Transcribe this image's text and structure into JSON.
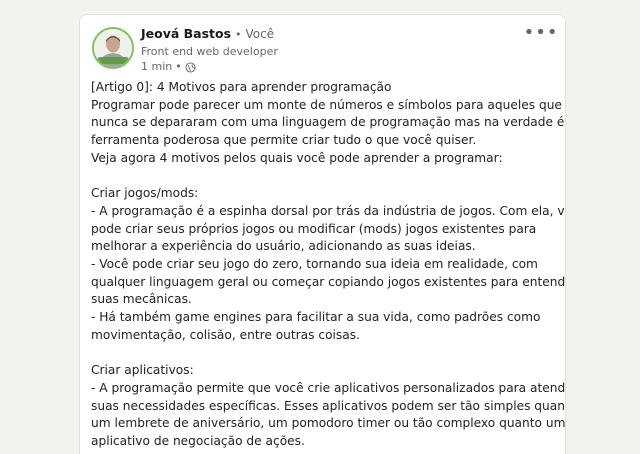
{
  "post": {
    "author": "Jeová Bastos",
    "separator": "•",
    "relation": "Você",
    "headline": "Front end web developer",
    "time": "1 min",
    "visibility_icon": "globe-icon",
    "more_icon": "more-options-icon",
    "more_label": "•••",
    "avatar_badge_color": "#7fc15e",
    "lines": [
      "[Artigo 0]: 4 Motivos para aprender programação",
      "Programar pode parecer um monte de números e símbolos para aqueles que",
      "nunca se depararam com uma linguagem de programação mas na verdade é uma",
      "ferramenta poderosa que permite criar tudo o que você quiser.",
      "Veja agora 4 motivos pelos quais você pode aprender a programar:",
      "",
      "Criar jogos/mods:",
      "- A programação é a espinha dorsal por trás da indústria de jogos. Com ela, você",
      "pode criar seus próprios jogos ou modificar (mods) jogos existentes para",
      "melhorar a experiência do usuário, adicionando as suas ideias.",
      "- Você pode criar seu jogo do zero, tornando sua ideia em realidade, com",
      "qualquer linguagem geral ou começar copiando jogos existentes para entender",
      "suas mecânicas.",
      "- Há também game engines para facilitar a sua vida, como padrões como",
      "movimentação, colisão, entre outras coisas.",
      "",
      "Criar aplicativos:",
      "- A programação permite que você crie aplicativos personalizados para atender às",
      "suas necessidades específicas. Esses aplicativos podem ser tão simples quanto",
      "um lembrete de aniversário, um pomodoro timer ou tão complexo quanto um",
      "aplicativo de negociação de ações."
    ]
  }
}
